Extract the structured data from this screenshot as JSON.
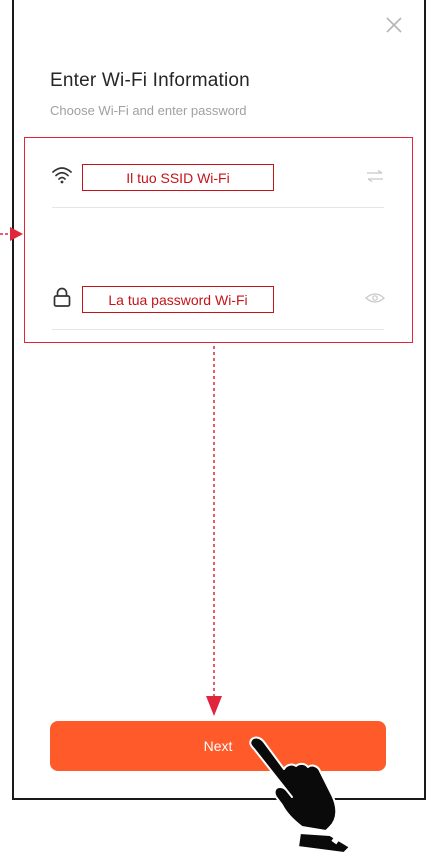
{
  "screen": {
    "title": "Enter Wi-Fi Information",
    "subtitle": "Choose Wi-Fi and enter password"
  },
  "fields": {
    "ssid": {
      "label": "Il tuo SSID Wi-Fi",
      "icon": "wifi-icon",
      "action_icon": "swap-icon"
    },
    "password": {
      "label": "La tua password Wi-Fi",
      "icon": "lock-icon",
      "action_icon": "eye-icon"
    }
  },
  "actions": {
    "next_label": "Next",
    "close_icon": "close-icon"
  },
  "annotations": {
    "highlight_color": "#e0263b",
    "pointer_icon": "pointing-hand-icon"
  },
  "colors": {
    "accent": "#ff5a2a",
    "annotation": "#c4141a"
  }
}
